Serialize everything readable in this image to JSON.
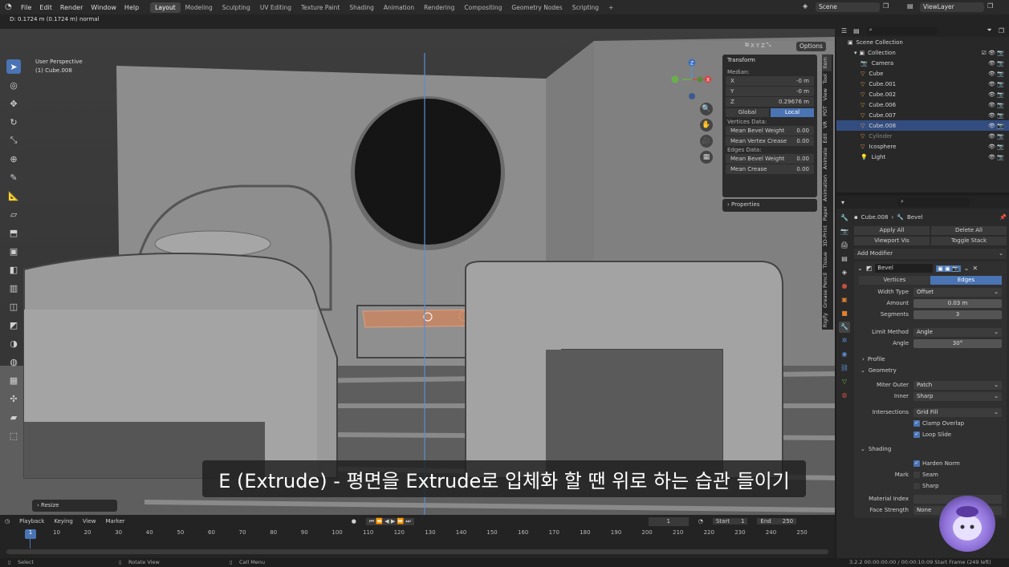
{
  "menu": {
    "items": [
      "File",
      "Edit",
      "Render",
      "Window",
      "Help"
    ]
  },
  "workspaces": [
    "Layout",
    "Modeling",
    "Sculpting",
    "UV Editing",
    "Texture Paint",
    "Shading",
    "Animation",
    "Rendering",
    "Compositing",
    "Geometry Nodes",
    "Scripting",
    "+"
  ],
  "header_right": {
    "scene": "Scene",
    "view_layer": "ViewLayer"
  },
  "status_line": "D: 0.1724 m (0.1724 m) normal",
  "viewport": {
    "view_name": "User Perspective",
    "object_label": "(1) Cube.008",
    "options": "Options",
    "axes": [
      "X",
      "Y",
      "Z"
    ]
  },
  "npanel": {
    "title": "Transform",
    "median": "Median:",
    "x_label": "X",
    "x_val": "-0 m",
    "y_label": "Y",
    "y_val": "-0 m",
    "z_label": "Z",
    "z_val": "0.29676 m",
    "global": "Global",
    "local": "Local",
    "vertices_data": "Vertices Data:",
    "mean_bevel_weight": "Mean Bevel Weight",
    "mbw_val": "0.00",
    "mean_vertex_crease": "Mean Vertex Crease",
    "mvc_val": "0.00",
    "edges_data": "Edges Data:",
    "mean_bevel_weight2": "Mean Bevel Weight",
    "mbw2_val": "0.00",
    "mean_crease": "Mean Crease",
    "mc_val": "0.00",
    "properties": "Properties"
  },
  "vtabs": [
    "Item",
    "Tool",
    "View",
    "PDT",
    "VR",
    "Edit",
    "Animate",
    "Animation",
    "Paper",
    "3D-Print",
    "Tissue",
    "Grease Pencil",
    "Rigify"
  ],
  "outliner": {
    "scene_collection": "Scene Collection",
    "collection": "Collection",
    "items": [
      {
        "name": "Camera",
        "sel": false
      },
      {
        "name": "Cube",
        "sel": false
      },
      {
        "name": "Cube.001",
        "sel": false
      },
      {
        "name": "Cube.002",
        "sel": false
      },
      {
        "name": "Cube.006",
        "sel": false
      },
      {
        "name": "Cube.007",
        "sel": false
      },
      {
        "name": "Cube.008",
        "sel": true
      },
      {
        "name": "Cylinder",
        "sel": false
      },
      {
        "name": "Icosphere",
        "sel": false
      },
      {
        "name": "Light",
        "sel": false
      }
    ]
  },
  "properties": {
    "breadcrumb_obj": "Cube.008",
    "breadcrumb_mod": "Bevel",
    "apply_all": "Apply All",
    "delete_all": "Delete All",
    "viewport_vis": "Viewport Vis",
    "toggle_stack": "Toggle Stack",
    "add_modifier": "Add Modifier",
    "modifier_name": "Bevel",
    "vertices": "Vertices",
    "edges": "Edges",
    "width_type_k": "Width Type",
    "width_type_v": "Offset",
    "amount_k": "Amount",
    "amount_v": "0.03 m",
    "segments_k": "Segments",
    "segments_v": "3",
    "limit_method_k": "Limit Method",
    "limit_method_v": "Angle",
    "angle_k": "Angle",
    "angle_v": "30°",
    "profile": "Profile",
    "geometry": "Geometry",
    "miter_outer_k": "Miter Outer",
    "miter_outer_v": "Patch",
    "inner_k": "Inner",
    "inner_v": "Sharp",
    "intersections_k": "Intersections",
    "intersections_v": "Grid Fill",
    "clamp_overlap": "Clamp Overlap",
    "loop_slide": "Loop Slide",
    "shading": "Shading",
    "harden_normals": "Harden Norm",
    "mark_k": "Mark",
    "seam": "Seam",
    "sharp": "Sharp",
    "material_index_k": "Material Index",
    "face_strength_k": "Face Strength",
    "face_strength_v": "None"
  },
  "timeline": {
    "playback": "Playback",
    "keying": "Keying",
    "view": "View",
    "marker": "Marker",
    "current": "1",
    "start_label": "Start",
    "start": "1",
    "end_label": "End",
    "end": "250",
    "ticks": [
      "10",
      "20",
      "30",
      "40",
      "50",
      "60",
      "70",
      "80",
      "90",
      "100",
      "110",
      "120",
      "130",
      "140",
      "150",
      "160",
      "170",
      "180",
      "190",
      "200",
      "210",
      "220",
      "230",
      "240",
      "250"
    ],
    "frame_marker": "1"
  },
  "operator": "Resize",
  "subtitle": "E (Extrude) - 평면을 Extrude로 입체화 할 땐 위로 하는 습관 들이기",
  "status": {
    "select": "Select",
    "rotate": "Rotate View",
    "call_menu": "Call Menu",
    "right": "3.2.2  00:00:00:00 / 00:00:10:09  Start Frame (249 left)"
  }
}
